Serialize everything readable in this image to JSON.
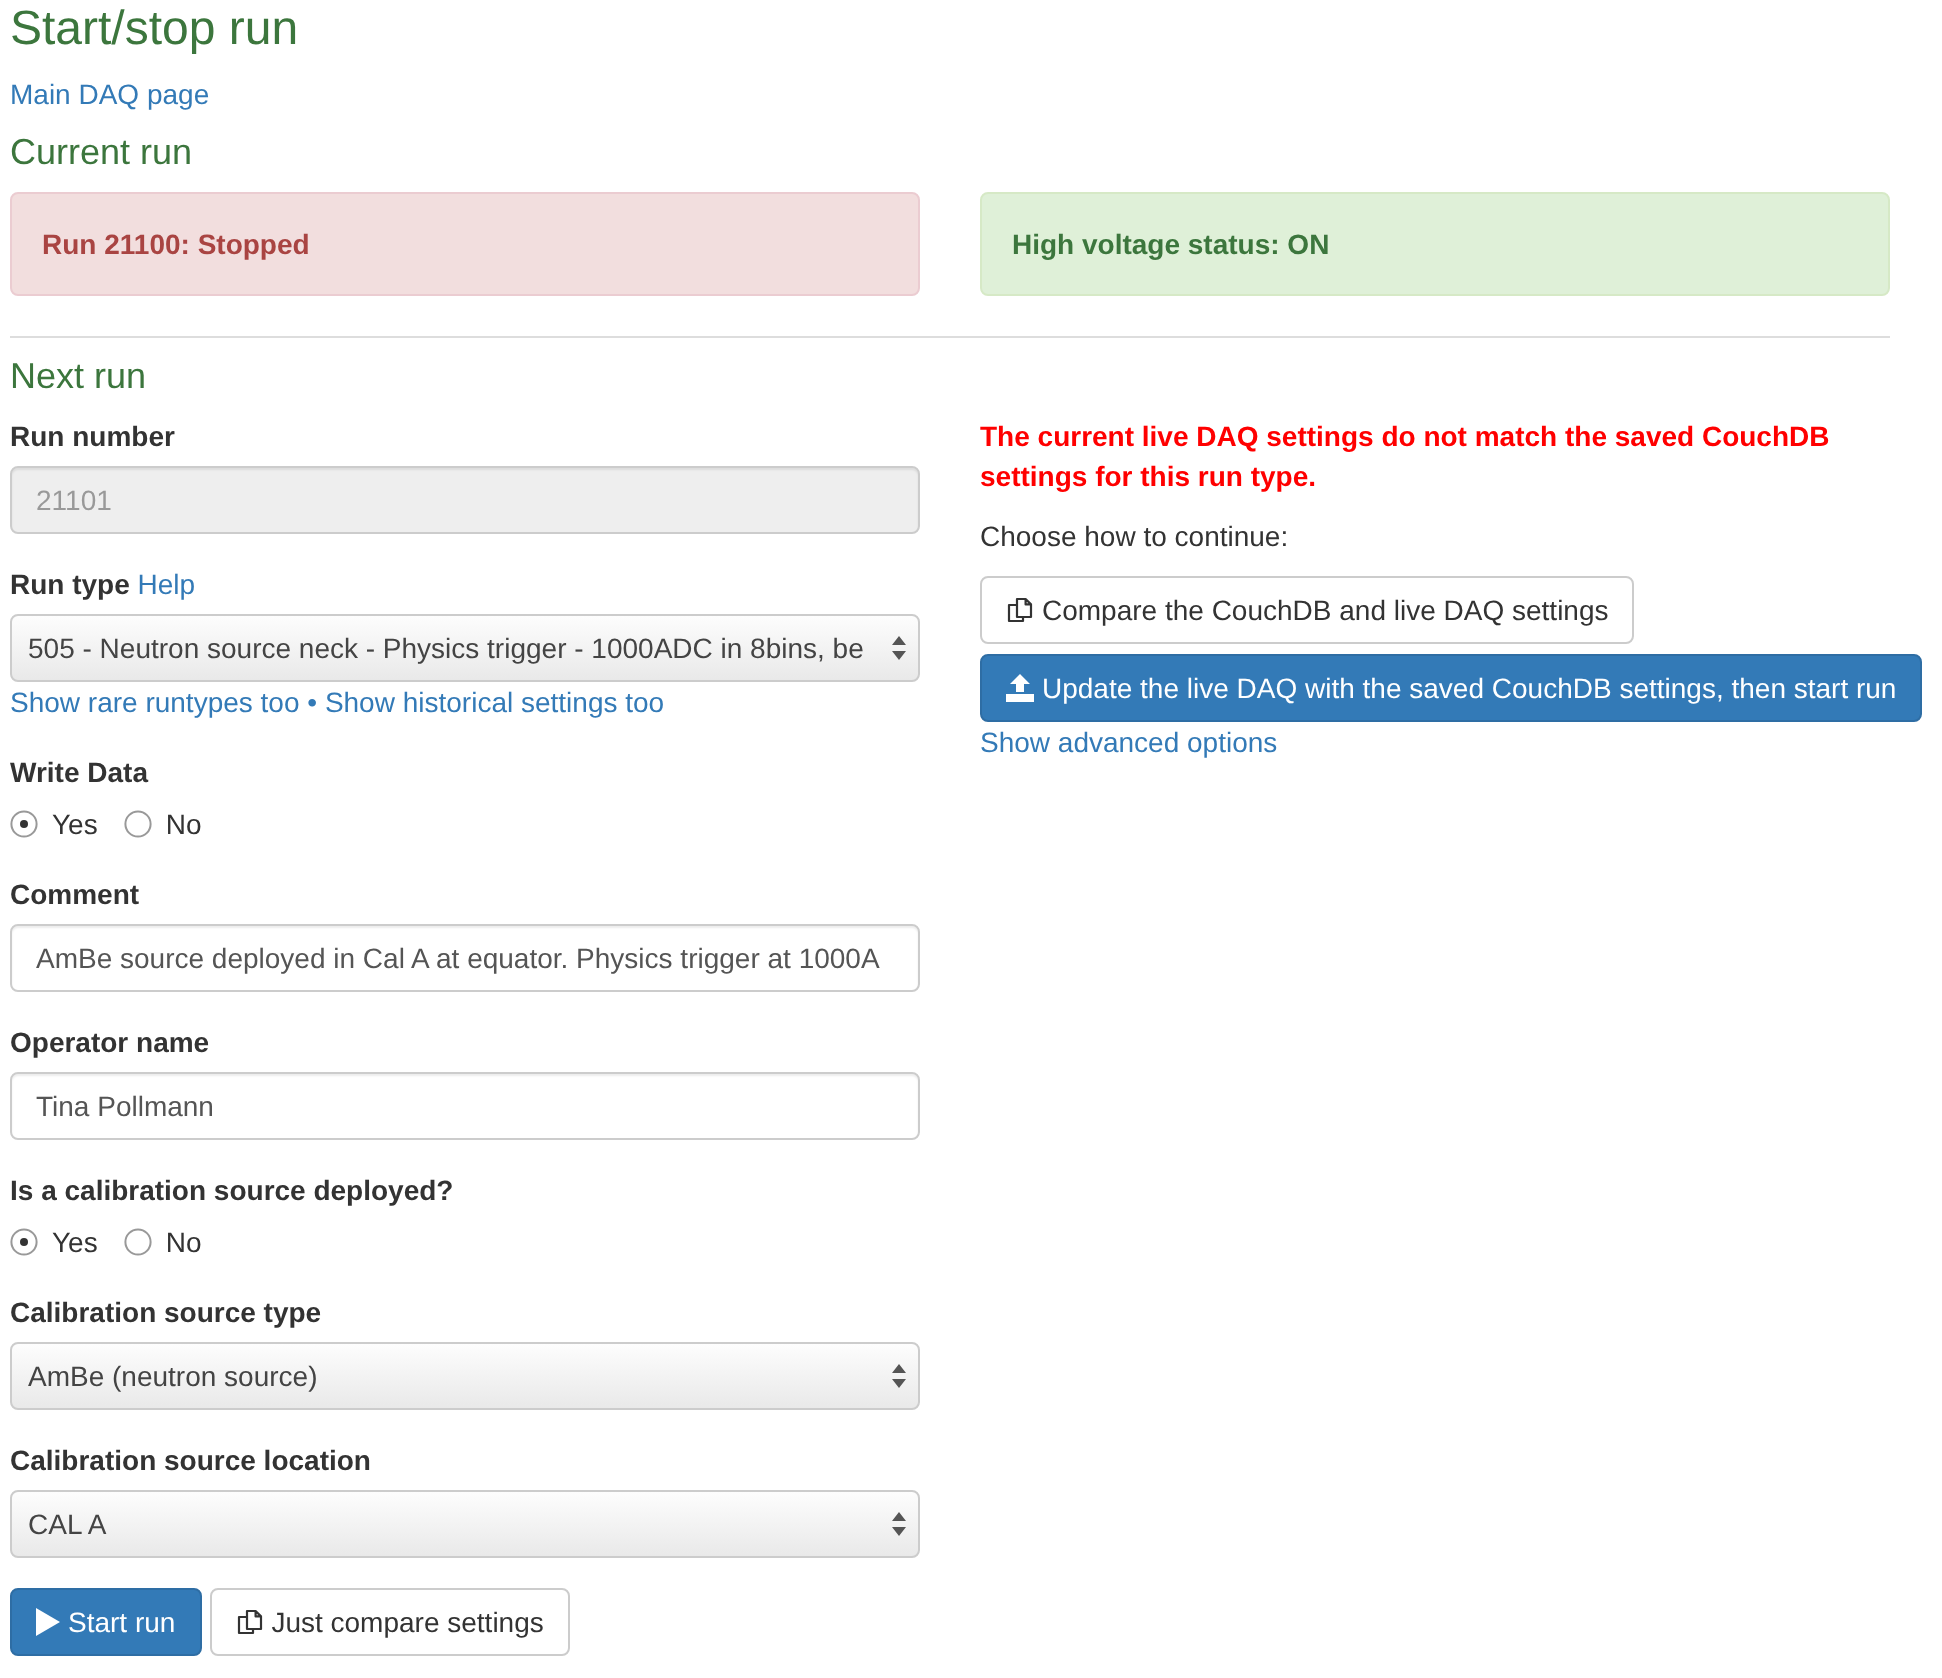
{
  "title": "Start/stop run",
  "main_link": "Main DAQ page",
  "current_run": {
    "heading": "Current run",
    "alerts": [
      {
        "kind": "danger",
        "text": "Run 21100: Stopped"
      },
      {
        "kind": "success",
        "text": "High voltage status: ON"
      }
    ]
  },
  "next_run": {
    "heading": "Next run",
    "fields": [
      {
        "kind": "input",
        "label": "Run number",
        "value": "21101",
        "disabled": true
      },
      {
        "kind": "select",
        "label": "Run type",
        "help_link": "Help",
        "value": "505 - Neutron source neck - Physics trigger - 1000ADC in 8bins, be",
        "disabled": false,
        "links": [
          "Show rare runtypes too",
          "Show historical settings too"
        ],
        "separator": "•"
      },
      {
        "kind": "radio",
        "label": "Write Data",
        "options": [
          {
            "label": "Yes",
            "selected": true
          },
          {
            "label": "No",
            "selected": false
          }
        ]
      },
      {
        "kind": "input",
        "label": "Comment",
        "value": "AmBe source deployed in Cal A at equator. Physics trigger at 1000A",
        "disabled": false
      },
      {
        "kind": "input",
        "label": "Operator name",
        "value": "Tina Pollmann",
        "disabled": false
      },
      {
        "kind": "radio",
        "label": "Is a calibration source deployed?",
        "options": [
          {
            "label": "Yes",
            "selected": true
          },
          {
            "label": "No",
            "selected": false
          }
        ]
      },
      {
        "kind": "select",
        "label": "Calibration source type",
        "value": "AmBe (neutron source)",
        "disabled": false
      },
      {
        "kind": "select",
        "label": "Calibration source location",
        "value": "CAL A",
        "disabled": false
      }
    ],
    "actions": [
      {
        "kind": "start",
        "label": "Start run"
      },
      {
        "kind": "compare",
        "label": "Just compare settings"
      }
    ],
    "settings_check": {
      "warning": "The current live DAQ settings do not match the saved CouchDB settings for this run type.",
      "prompt": "Choose how to continue:",
      "actions": [
        {
          "kind": "compare",
          "label": "Compare the CouchDB and live DAQ settings"
        },
        {
          "kind": "update",
          "label": "Update the live DAQ with the saved CouchDB settings, then start run"
        }
      ],
      "link": "Show advanced options"
    }
  }
}
